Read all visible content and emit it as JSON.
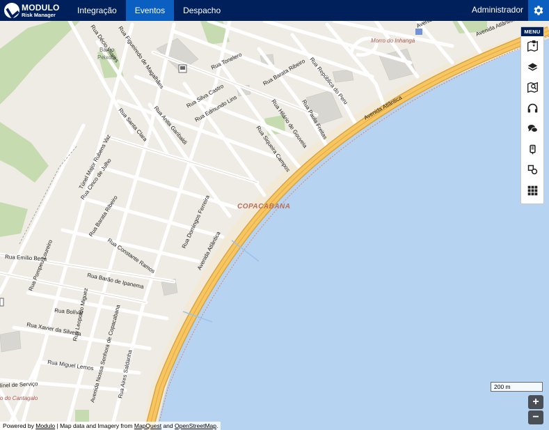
{
  "header": {
    "logo_title": "MODULO",
    "logo_subtitle": "Risk Manager",
    "tabs": [
      {
        "label": "Integração",
        "active": false
      },
      {
        "label": "Eventos",
        "active": true
      },
      {
        "label": "Despacho",
        "active": false
      }
    ],
    "user_name": "Administrador",
    "settings_icon": "gear-icon"
  },
  "map": {
    "district_label": "COPACABANA",
    "hill_label": "Morro do Inhangá",
    "cantagalo_label": "o do Cantagalo",
    "neighborhood_label_1": "Bairro",
    "neighborhood_label_2": "Peixoto",
    "streets": {
      "avenida_atlantica_1": "Avenida Atlântica",
      "avenida_atlantica_2": "Avenida Atlântica",
      "avenida_atlantica_3": "Avenida Atlântica",
      "avenida_atlantica_4": "Avenida Atlântica",
      "barata_ribeiro_1": "Rua Barata Ribeiro",
      "barata_ribeiro_2": "Rua Barata Ribeiro",
      "toneleros": "Rua Tonelero",
      "republica_peru": "Rua República do Peru",
      "silva_castro": "Rua Silva Castro",
      "edmundo_lins": "Rua Edmundo Lins",
      "hilario_gouveia": "Rua Hilário de Gouveia",
      "paula_freitas": "Rua Paula Freitas",
      "santa_clara": "Rua Santa Clara",
      "anita_garibaldi": "Rua Anita Garibaldi",
      "siqueira_campos": "Rua Siqueira Campos",
      "figueiredo_magalhaes": "Rua Figueiredo de Magalhães",
      "duvivier": "Rua Décio Vilares",
      "tunel_rubens_vaz": "Túnel Major Rubens Vaz",
      "cinco_julho": "Rua Cinco de Julho",
      "domingos_ferreira": "Rua Domingos Ferreira",
      "constante_ramos": "Rua Constante Ramos",
      "emilio_berla": "Rua Emílio Berla",
      "pompeu_loureiro": "Rua Pompeu Loureiro",
      "barao_ipanema": "Rua Barão de Ipanema",
      "bolivar": "Rua Bolívar",
      "leopoldo_miguez": "Rua Leopoldo Miguez",
      "xavier_silveira": "Rua Xavier da Silveira",
      "ns_copacabana": "Avenida Nossa Senhora de Copacabana",
      "miguel_lemos": "Rua Miguel Lemos",
      "aires_saldanha": "Rua Aires Saldanha",
      "servico": "línel de Serviço"
    },
    "scale_label": "200 m",
    "zoom_in_label": "+",
    "zoom_out_label": "−"
  },
  "toolbar": {
    "menu_label": "MENU",
    "tools": [
      {
        "name": "map-marker-tool",
        "icon": "map-marker-icon"
      },
      {
        "name": "layers-tool",
        "icon": "layers-icon"
      },
      {
        "name": "map-search-tool",
        "icon": "map-search-icon"
      },
      {
        "name": "headset-tool",
        "icon": "headset-icon"
      },
      {
        "name": "chat-tool",
        "icon": "chat-icon"
      },
      {
        "name": "device-tool",
        "icon": "device-icon"
      },
      {
        "name": "shapes-tool",
        "icon": "shapes-icon"
      },
      {
        "name": "grid-tool",
        "icon": "grid-icon"
      }
    ]
  },
  "footer": {
    "prefix": "Powered by ",
    "link_modulo": "Modulo",
    "middle": " | Map data and Imagery from ",
    "link_mapquest": "MapQuest",
    "and": " and ",
    "link_osm": "OpenStreetMap",
    "suffix": "."
  },
  "colors": {
    "header_bg": "#00205c",
    "active_tab": "#0a5fc1",
    "sea": "#b6d3f2",
    "land": "#eeece5",
    "park": "#c6dcb0",
    "main_road": "#f5c661",
    "beach": "#f2ead7"
  }
}
